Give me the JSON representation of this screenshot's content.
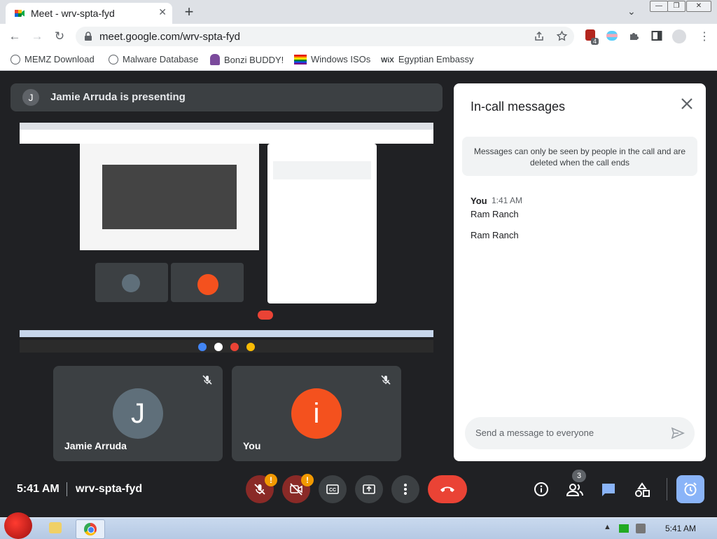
{
  "browser": {
    "tab_title": "Meet - wrv-spta-fyd",
    "url": "meet.google.com/wrv-spta-fyd",
    "extension_badge": "4",
    "bookmarks": [
      "MEMZ Download",
      "Malware Database",
      "Bonzi BUDDY!",
      "Windows ISOs",
      "Egyptian Embassy"
    ]
  },
  "meet": {
    "presenter_initial": "J",
    "presenting_text": "Jamie Arruda is presenting",
    "tiles": [
      {
        "initial": "J",
        "name": "Jamie Arruda",
        "color": "#5f6f7a"
      },
      {
        "initial": "i",
        "name": "You",
        "color": "#f4511e"
      }
    ],
    "chat": {
      "title": "In-call messages",
      "notice": "Messages can only be seen by people in the call and are deleted when the call ends",
      "sender": "You",
      "time": "1:41 AM",
      "messages": [
        "Ram Ranch",
        "Ram Ranch"
      ],
      "input_placeholder": "Send a message to everyone"
    },
    "bottom": {
      "time": "5:41 AM",
      "meeting_code": "wrv-spta-fyd",
      "mic_badge": "!",
      "cam_badge": "!",
      "people_count": "3"
    }
  },
  "taskbar": {
    "time": "5:41 AM"
  },
  "colors": {
    "accent": "#8ab4f8",
    "hangup": "#ea4335",
    "warning": "#f29900",
    "you_avatar": "#f4511e"
  }
}
